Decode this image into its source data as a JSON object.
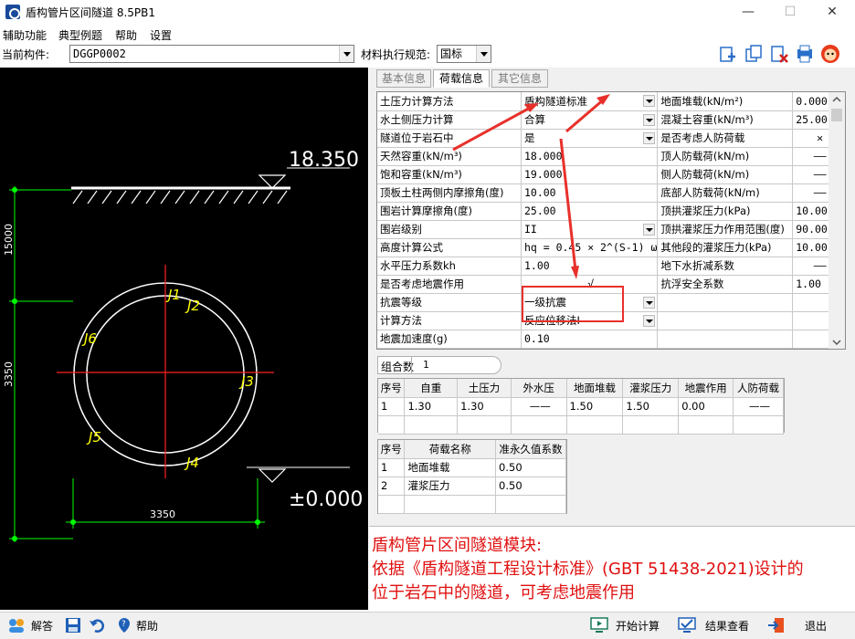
{
  "window": {
    "title": "盾构管片区间隧道 8.5PB1",
    "minimize": "—",
    "maximize": "☐",
    "close": "✕"
  },
  "menu": [
    "辅助功能",
    "典型例题",
    "帮助",
    "设置"
  ],
  "toolbar": {
    "component_label": "当前构件:",
    "component_value": "DGGP0002",
    "spec_label": "材料执行规范:",
    "spec_value": "国标"
  },
  "drawing": {
    "elev_top": "18.350",
    "elev_bottom": "±0.000",
    "dim_top": "15000",
    "dim_mid": "3350",
    "dim_width": "3350",
    "joints": [
      "J1",
      "J2",
      "J3",
      "J4",
      "J5",
      "J6"
    ]
  },
  "tabs": [
    "基本信息",
    "荷载信息",
    "其它信息"
  ],
  "params": [
    [
      "土压力计算方法",
      "盾构隧道标准",
      "地面堆载(kN/m²)",
      "0.000"
    ],
    [
      "水土侧压力计算",
      "合算",
      "混凝土容重(kN/m³)",
      "25.00"
    ],
    [
      "隧道位于岩石中",
      "是",
      "是否考虑人防荷载",
      "✕"
    ],
    [
      "天然容重(kN/m³)",
      "18.000",
      "顶人防载荷(kN/m)",
      "——"
    ],
    [
      "饱和容重(kN/m³)",
      "19.000",
      "侧人防载荷(kN/m)",
      "——"
    ],
    [
      "顶板土柱两侧内摩擦角(度)",
      "10.00",
      "底部人防载荷(kN/m)",
      "——"
    ],
    [
      "围岩计算摩擦角(度)",
      "25.00",
      "顶拱灌浆压力(kPa)",
      "10.00"
    ],
    [
      "围岩级别",
      "II",
      "顶拱灌浆压力作用范围(度)",
      "90.00"
    ],
    [
      "高度计算公式",
      "hq = 0.45 × 2^(S-1) ω",
      "其他段的灌浆压力(kPa)",
      "10.00"
    ],
    [
      "水平压力系数kh",
      "1.00",
      "地下水折减系数",
      "——"
    ],
    [
      "是否考虑地震作用",
      "√",
      "抗浮安全系数",
      "1.00"
    ],
    [
      "抗震等级",
      "一级抗震",
      "",
      ""
    ],
    [
      "计算方法",
      "反应位移法Ⅰ",
      "",
      ""
    ],
    [
      "地震加速度(g)",
      "0.10",
      "",
      ""
    ]
  ],
  "combo": {
    "label": "组合数",
    "value": "1"
  },
  "load_table": {
    "headers": [
      "序号",
      "自重",
      "土压力",
      "外水压",
      "地面堆载",
      "灌浆压力",
      "地震作用",
      "人防荷载"
    ],
    "rows": [
      [
        "1",
        "1.30",
        "1.30",
        "——",
        "1.50",
        "1.50",
        "0.00",
        "——"
      ]
    ]
  },
  "quasi_table": {
    "headers": [
      "序号",
      "荷载名称",
      "准永久值系数"
    ],
    "rows": [
      [
        "1",
        "地面堆载",
        "0.50"
      ],
      [
        "2",
        "灌浆压力",
        "0.50"
      ]
    ]
  },
  "info": {
    "line1": "盾构管片区间隧道模块:",
    "line2": "依据《盾构隧道工程设计标准》(GBT 51438-2021)设计的",
    "line3": "位于岩石中的隧道，可考虑地震作用"
  },
  "statusbar": {
    "answer": "解答",
    "help": "帮助",
    "calc": "开始计算",
    "results": "结果查看",
    "exit": "退出"
  },
  "colors": {
    "annotation_red": "#e8302a",
    "drawing_green": "#00ff00",
    "joint_yellow": "#ffff00"
  }
}
